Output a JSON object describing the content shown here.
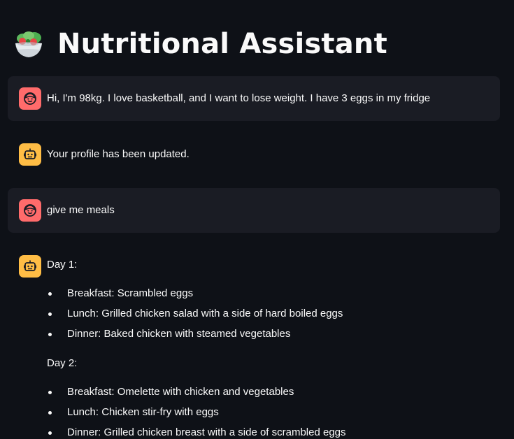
{
  "header": {
    "title": "Nutritional Assistant",
    "icon": "salad-emoji-icon"
  },
  "colors": {
    "background": "#0e1117",
    "user_message_bg": "#1a1c24",
    "user_avatar": "#ff6b6b",
    "assistant_avatar": "#ffbd45",
    "text": "#fafafa"
  },
  "messages": [
    {
      "role": "user",
      "avatar": "user-face-icon",
      "text": "Hi, I'm 98kg. I love basketball, and I want to lose weight. I have 3 eggs in my fridge"
    },
    {
      "role": "assistant",
      "avatar": "robot-icon",
      "text": "Your profile has been updated."
    },
    {
      "role": "user",
      "avatar": "user-face-icon",
      "text": "give me meals"
    },
    {
      "role": "assistant",
      "avatar": "robot-icon",
      "days": [
        {
          "heading": "Day 1:",
          "meals": [
            "Breakfast: Scrambled eggs",
            "Lunch: Grilled chicken salad with a side of hard boiled eggs",
            "Dinner: Baked chicken with steamed vegetables"
          ]
        },
        {
          "heading": "Day 2:",
          "meals": [
            "Breakfast: Omelette with chicken and vegetables",
            "Lunch: Chicken stir-fry with eggs",
            "Dinner: Grilled chicken breast with a side of scrambled eggs"
          ]
        }
      ]
    }
  ]
}
